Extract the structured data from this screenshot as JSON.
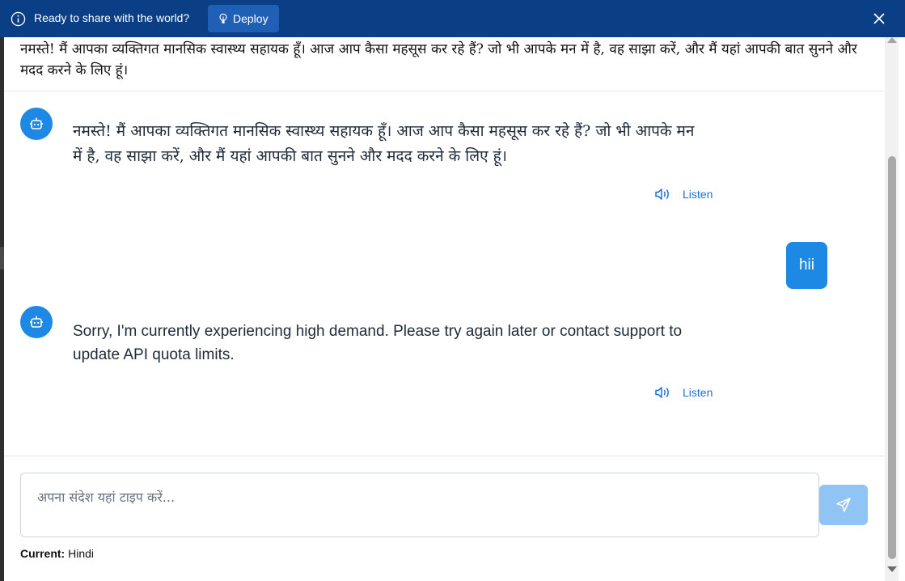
{
  "topbar": {
    "ready_text": "Ready to share with the world?",
    "deploy_label": "Deploy",
    "bg_color": "#0b3f85"
  },
  "header": {
    "message": "नमस्ते! मैं आपका व्यक्तिगत मानसिक स्वास्थ्य सहायक हूँ। आज आप कैसा महसूस कर रहे हैं? जो भी आपके मन में है, वह साझा करें, और मैं यहां आपकी बात सुनने और मदद करने के लिए हूं।"
  },
  "chat": {
    "messages": [
      {
        "role": "bot",
        "text": "नमस्ते! मैं आपका व्यक्तिगत मानसिक स्वास्थ्य सहायक हूँ। आज आप कैसा महसूस कर रहे हैं? जो भी आपके मन में है, वह साझा करें, और मैं यहां आपकी बात सुनने और मदद करने के लिए हूं।",
        "listen_label": "Listen"
      },
      {
        "role": "user",
        "text": "hii"
      },
      {
        "role": "bot",
        "text": "Sorry, I'm currently experiencing high demand. Please try again later or contact support to update API quota limits.",
        "listen_label": "Listen"
      }
    ]
  },
  "composer": {
    "placeholder": "अपना संदेश यहां टाइप करें...",
    "current_label": "Current:",
    "current_value": "Hindi"
  },
  "colors": {
    "accent": "#1e88e5",
    "send_disabled": "#90c4f5",
    "link": "#1e6fd9"
  }
}
